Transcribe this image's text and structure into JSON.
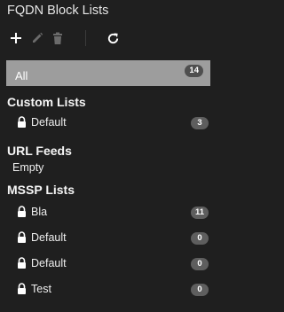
{
  "panel": {
    "title": "FQDN Block Lists"
  },
  "toolbar": {
    "add_icon": "plus-icon",
    "edit_icon": "pencil-icon",
    "delete_icon": "trash-icon",
    "refresh_icon": "refresh-icon"
  },
  "all": {
    "label": "All",
    "count": "14"
  },
  "custom_lists": {
    "heading": "Custom Lists",
    "items": [
      {
        "label": "Default",
        "count": "3"
      }
    ]
  },
  "url_feeds": {
    "heading": "URL Feeds",
    "empty_text": "Empty"
  },
  "mssp_lists": {
    "heading": "MSSP Lists",
    "items": [
      {
        "label": "Bla",
        "count": "11"
      },
      {
        "label": "Default",
        "count": "0"
      },
      {
        "label": "Default",
        "count": "0"
      },
      {
        "label": "Test",
        "count": "0"
      }
    ]
  },
  "colors": {
    "background": "#1f1f1f",
    "selected_row": "#9d9d9d",
    "badge": "#5e5e5e"
  }
}
